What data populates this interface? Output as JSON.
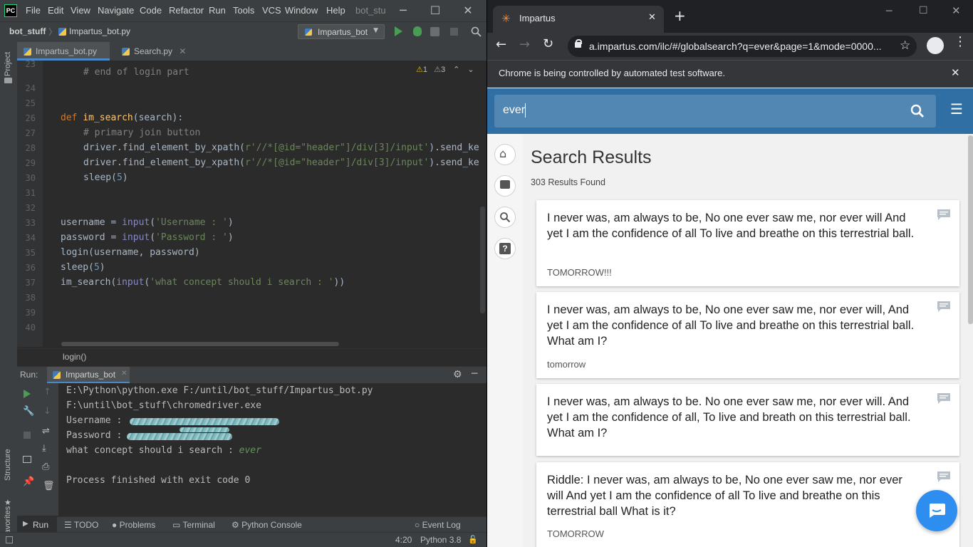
{
  "ide": {
    "logo": "PC",
    "menu": [
      "File",
      "Edit",
      "View",
      "Navigate",
      "Code",
      "Refactor",
      "Run",
      "Tools",
      "VCS",
      "Window",
      "Help"
    ],
    "title_fragment": "bot_stu",
    "project_name": "bot_stuff",
    "file_name": "Impartus_bot.py",
    "run_config": "Impartus_bot",
    "tabs": [
      "Impartus_bot.py",
      "Search.py"
    ],
    "side_labels": {
      "project": "Project",
      "structure": "Structure",
      "favorites": "Favorites"
    },
    "inspection": {
      "warnings": "1",
      "weak_warnings": "3"
    },
    "code": {
      "line_numbers": [
        "23",
        "24",
        "25",
        "26",
        "27",
        "28",
        "29",
        "30",
        "31",
        "32",
        "33",
        "34",
        "35",
        "36",
        "37",
        "38",
        "39",
        "40"
      ],
      "l23": "# end of login part",
      "l26_kw": "def ",
      "l26_fn": "im_search",
      "l26_rest": "(search):",
      "l27": "# primary join button",
      "l28_a": "driver.find_element_by_xpath(",
      "l28_b": "r'//*[@id=\"header\"]/div[3]/input'",
      "l28_c": ").send_ke",
      "l29_a": "driver.find_element_by_xpath(",
      "l29_b": "r'//*[@id=\"header\"]/div[3]/input'",
      "l29_c": ").send_ke",
      "l30_a": "sleep(",
      "l30_b": "5",
      "l30_c": ")",
      "l33_a": "username = ",
      "l33_b": "input",
      "l33_c": "(",
      "l33_d": "'Username : '",
      "l33_e": ")",
      "l34_a": "password = ",
      "l34_b": "input",
      "l34_c": "(",
      "l34_d": "'Password : '",
      "l34_e": ")",
      "l35": "login(username, password)",
      "l36_a": "sleep(",
      "l36_b": "5",
      "l36_c": ")",
      "l37_a": "im_search(",
      "l37_b": "input",
      "l37_c": "(",
      "l37_d": "'what concept should i search : '",
      "l37_e": "))"
    },
    "breadcrumb": "login()",
    "run_panel": {
      "label": "Run:",
      "tab": "Impartus_bot",
      "lines": [
        "E:\\Python\\python.exe F:/until/bot_stuff/Impartus_bot.py",
        "F:\\until\\bot_stuff\\chromedriver.exe",
        "Username : ",
        "Password : ",
        "what concept should i search : ",
        "Process finished with exit code 0"
      ],
      "user_input": "ever"
    },
    "tool_windows": [
      "Run",
      "TODO",
      "Problems",
      "Terminal",
      "Python Console"
    ],
    "event_log": "Event Log",
    "status": {
      "position": "4:20",
      "interpreter": "Python 3.8"
    }
  },
  "browser": {
    "tab_title": "Impartus",
    "url": "a.impartus.com/ilc/#/globalsearch?q=ever&page=1&mode=0000...",
    "automation_notice": "Chrome is being controlled by automated test software.",
    "search_value": "ever",
    "page_title": "Search Results",
    "results_count": "303 Results Found",
    "results": [
      {
        "text": "I never was, am always to be, No one ever saw me, nor ever will And yet I am the confidence of all To live and breathe on this terrestrial ball.",
        "tag": "TOMORROW!!!"
      },
      {
        "text": "I never was, am always to be, No one ever saw me, nor ever will, And yet I am the confidence of all To live and breathe on this terrestrial ball. What am I?",
        "tag": "tomorrow"
      },
      {
        "text": "I never was, am always to be. No one ever saw me, nor ever will. And yet I am the confidence of all, To live and breath on this terrestrial ball. What am I?",
        "tag": ""
      },
      {
        "text": "Riddle: I never was, am always to be, No one ever saw me, nor ever will And yet I am the confidence of all To live and breathe on this terrestrial ball What is it?",
        "tag": "TOMORROW"
      }
    ]
  },
  "colors": {
    "accent": "#4a88c7",
    "site_header": "#2f6fa3",
    "fab": "#2e8ef0"
  }
}
